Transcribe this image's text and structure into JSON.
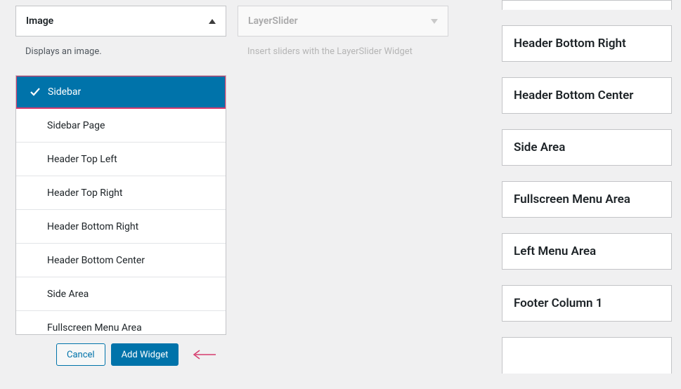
{
  "widgets": {
    "image": {
      "title": "Image",
      "description": "Displays an image."
    },
    "layerslider": {
      "title": "LayerSlider",
      "description": "Insert sliders with the LayerSlider Widget"
    }
  },
  "listbox": {
    "items": [
      {
        "label": "Sidebar",
        "selected": true
      },
      {
        "label": "Sidebar Page",
        "selected": false
      },
      {
        "label": "Header Top Left",
        "selected": false
      },
      {
        "label": "Header Top Right",
        "selected": false
      },
      {
        "label": "Header Bottom Right",
        "selected": false
      },
      {
        "label": "Header Bottom Center",
        "selected": false
      },
      {
        "label": "Side Area",
        "selected": false
      },
      {
        "label": "Fullscreen Menu Area",
        "selected": false
      }
    ]
  },
  "actions": {
    "cancel": "Cancel",
    "add_widget": "Add Widget"
  },
  "sidebar_areas": [
    "Header Bottom Right",
    "Header Bottom Center",
    "Side Area",
    "Fullscreen Menu Area",
    "Left Menu Area",
    "Footer Column 1"
  ]
}
